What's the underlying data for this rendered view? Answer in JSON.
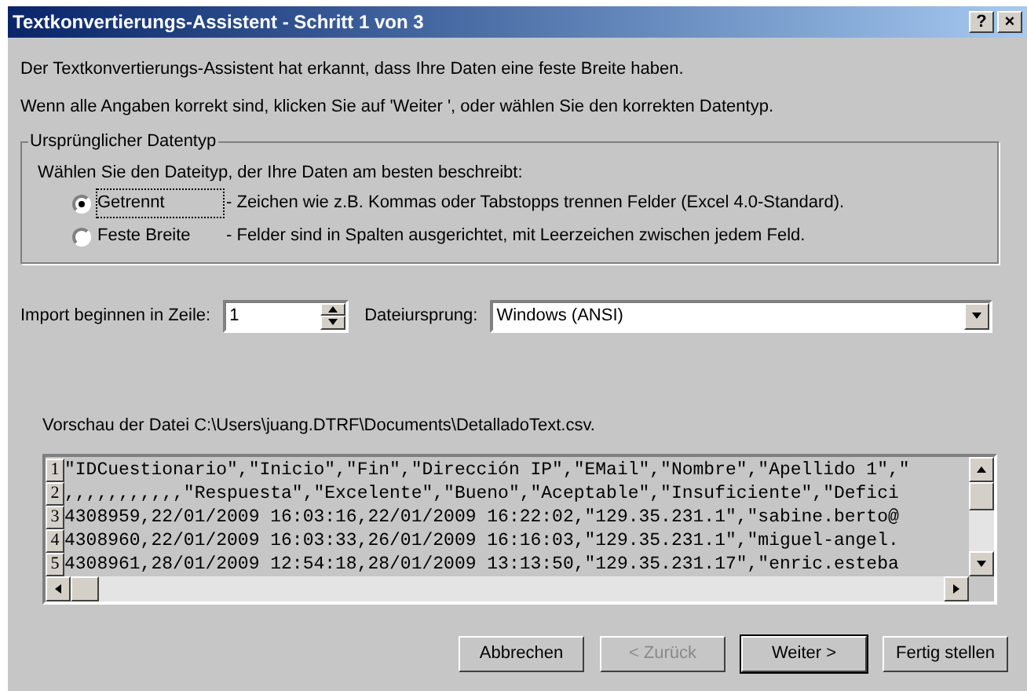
{
  "window": {
    "title": "Textkonvertierungs-Assistent - Schritt 1 von 3",
    "title_buttons": [
      "?",
      "×"
    ]
  },
  "intro": [
    "Der Textkonvertierungs-Assistent hat erkannt, dass Ihre Daten eine feste Breite haben.",
    "Wenn alle Angaben korrekt sind, klicken Sie auf 'Weiter ', oder wählen Sie den korrekten Datentyp."
  ],
  "group": {
    "title": "Ursprünglicher Datentyp",
    "prompt": "Wählen Sie den Dateityp, der Ihre Daten am besten beschreibt:",
    "options": [
      {
        "label": "Getrennt",
        "description": "- Zeichen wie z.B. Kommas oder Tabstopps trennen Felder (Excel 4.0-Standard).",
        "selected": true
      },
      {
        "label": "Feste Breite",
        "description": "- Felder sind in Spalten ausgerichtet, mit Leerzeichen zwischen jedem Feld.",
        "selected": false
      }
    ]
  },
  "start_row": {
    "label": "Import beginnen in Zeile:",
    "value": "1"
  },
  "origin": {
    "label": "Dateiursprung:",
    "value": "Windows (ANSI)"
  },
  "preview": {
    "label": "Vorschau der Datei C:\\Users\\juang.DTRF\\Documents\\DetalladoText.csv.",
    "rows": [
      {
        "number": "1",
        "text": "\"IDCuestionario\",\"Inicio\",\"Fin\",\"Dirección IP\",\"EMail\",\"Nombre\",\"Apellido 1\",\""
      },
      {
        "number": "2",
        "text": ",,,,,,,,,,,\"Respuesta\",\"Excelente\",\"Bueno\",\"Aceptable\",\"Insuficiente\",\"Defici"
      },
      {
        "number": "3",
        "text": "4308959,22/01/2009 16:03:16,22/01/2009 16:22:02,\"129.35.231.1\",\"sabine.berto@"
      },
      {
        "number": "4",
        "text": "4308960,22/01/2009 16:03:33,26/01/2009 16:16:03,\"129.35.231.1\",\"miguel-angel."
      },
      {
        "number": "5",
        "text": "4308961,28/01/2009 12:54:18,28/01/2009 13:13:50,\"129.35.231.17\",\"enric.esteba"
      }
    ]
  },
  "buttons": [
    {
      "label": "Abbrechen",
      "disabled": false,
      "default": false
    },
    {
      "label": "< Zurück",
      "disabled": true,
      "default": false
    },
    {
      "label": "Weiter >",
      "disabled": false,
      "default": true
    },
    {
      "label": "Fertig stellen",
      "disabled": false,
      "default": false
    }
  ]
}
